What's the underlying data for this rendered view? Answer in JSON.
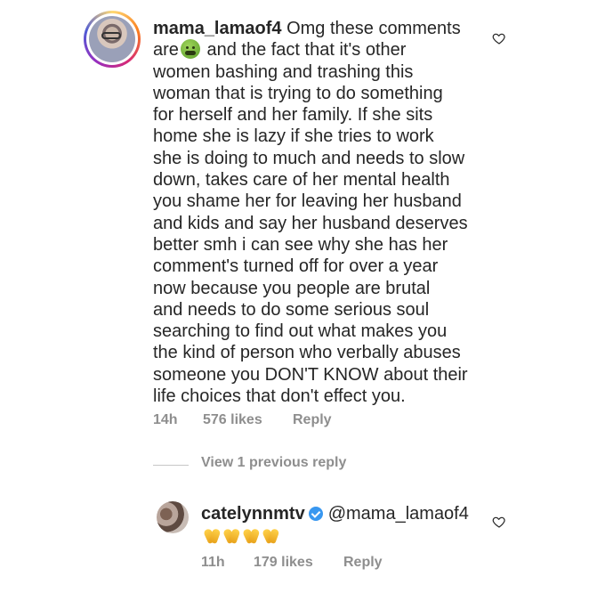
{
  "comment": {
    "username": "mama_lamaof4",
    "text_before_emoji": " Omg these comments\nare",
    "emoji_name": "nauseated-face-emoji",
    "text_after_emoji": " and the fact that it's other\nwomen bashing and trashing this\nwoman that is trying to do something\nfor herself and her family. If she sits\nhome she is lazy if she tries to work\nshe is doing to much and needs to slow\ndown, takes care of her mental health\nyou shame her for leaving her husband\nand kids and say her husband deserves\nbetter smh i can see why she has her\ncomment's turned off for over a year\nnow because you people are brutal\nand needs to do some serious soul\nsearching to find out what makes you\nthe kind of person who verbally abuses\nsomeone you DON'T KNOW about their\nlife choices that don't effect you.",
    "time": "14h",
    "likes": "576 likes",
    "reply_label": "Reply",
    "view_replies": "View 1 previous reply",
    "like_icon": "heart-outline-icon"
  },
  "reply": {
    "username": "catelynnmtv",
    "verified_icon": "verified-badge-icon",
    "mention": "@mama_lamaof4",
    "emoji_name": "clapping-hands-emoji",
    "emoji_count": 4,
    "time": "11h",
    "likes": "179 likes",
    "reply_label": "Reply",
    "like_icon": "heart-outline-icon"
  },
  "colors": {
    "text": "#262626",
    "secondary": "#8e8e8e",
    "verified": "#3897f0"
  }
}
